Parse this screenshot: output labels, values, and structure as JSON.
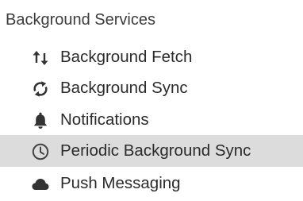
{
  "section": {
    "title": "Background Services"
  },
  "items": [
    {
      "label": "Background Fetch",
      "icon": "up-down-arrows-icon",
      "selected": false
    },
    {
      "label": "Background Sync",
      "icon": "sync-arrows-icon",
      "selected": false
    },
    {
      "label": "Notifications",
      "icon": "bell-icon",
      "selected": false
    },
    {
      "label": "Periodic Background Sync",
      "icon": "clock-icon",
      "selected": true
    },
    {
      "label": "Push Messaging",
      "icon": "cloud-icon",
      "selected": false
    }
  ],
  "colors": {
    "selected_background": "#dcdcdc",
    "icon_color": "#333333",
    "clock_icon_color": "#444444"
  }
}
